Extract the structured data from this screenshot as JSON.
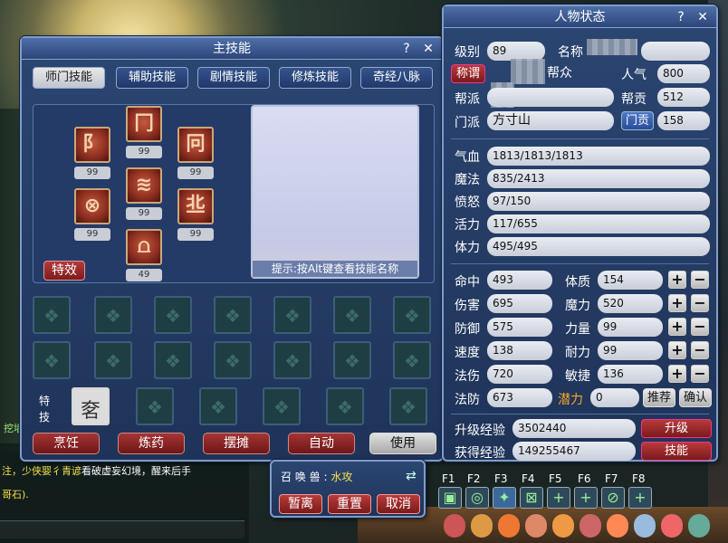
{
  "skill_window": {
    "title": "主技能",
    "help": "?",
    "close": "✕",
    "tabs": [
      "师门技能",
      "辅助技能",
      "剧情技能",
      "修炼技能",
      "奇经八脉"
    ],
    "skills": [
      {
        "glyph": "阝",
        "level": "99"
      },
      {
        "glyph": "冂",
        "level": "99"
      },
      {
        "glyph": "冋",
        "level": "99"
      },
      {
        "glyph": "⊗",
        "level": "99"
      },
      {
        "glyph": "≋",
        "level": "99"
      },
      {
        "glyph": "丠",
        "level": "99"
      },
      {
        "glyph": "⩍",
        "level": "49"
      }
    ],
    "tip": "提示:按Alt键查看技能名称",
    "effect_button": "特效",
    "special_label": "特技",
    "special_glyph": "㚚",
    "actions": [
      "烹饪",
      "炼药",
      "摆摊",
      "自动",
      "使用"
    ]
  },
  "status_window": {
    "title": "人物状态",
    "help": "?",
    "close": "✕",
    "level_label": "级别",
    "level_value": "89",
    "name_label": "名称",
    "title_button": "称谓",
    "title_value": "帮众",
    "popularity_label": "人气",
    "popularity_value": "800",
    "guild_label": "帮派",
    "guild_contrib_label": "帮贡",
    "guild_contrib_value": "512",
    "school_label": "门派",
    "school_value": "方寸山",
    "school_contrib_button": "门贡",
    "school_contrib_value": "158",
    "hp_label": "气血",
    "hp_value": "1813/1813/1813",
    "mp_label": "魔法",
    "mp_value": "835/2413",
    "rage_label": "愤怒",
    "rage_value": "97/150",
    "vigor_label": "活力",
    "vigor_value": "117/655",
    "stamina_label": "体力",
    "stamina_value": "495/495",
    "stats": [
      {
        "label": "命中",
        "value": "493",
        "attr_label": "体质",
        "attr_value": "154"
      },
      {
        "label": "伤害",
        "value": "695",
        "attr_label": "魔力",
        "attr_value": "520"
      },
      {
        "label": "防御",
        "value": "575",
        "attr_label": "力量",
        "attr_value": "99"
      },
      {
        "label": "速度",
        "value": "138",
        "attr_label": "耐力",
        "attr_value": "99"
      },
      {
        "label": "法伤",
        "value": "720",
        "attr_label": "敏捷",
        "attr_value": "136"
      }
    ],
    "mres_label": "法防",
    "mres_value": "673",
    "potential_label": "潜力",
    "potential_value": "0",
    "recommend_button": "推荐",
    "confirm_button": "确认",
    "upgrade_exp_label": "升级经验",
    "upgrade_exp_value": "3502440",
    "upgrade_button": "升级",
    "gained_exp_label": "获得经验",
    "gained_exp_value": "149255467",
    "skill_button": "技能",
    "plus": "+",
    "minus": "−"
  },
  "pet_window": {
    "label": "召 唤 兽 :",
    "pet_name": "水攻",
    "buttons": [
      "暂离",
      "重置",
      "取消"
    ]
  },
  "fkeys": [
    "F1",
    "F2",
    "F3",
    "F4",
    "F5",
    "F6",
    "F7",
    "F8"
  ],
  "chat": {
    "line1": "挖墙",
    "line2": "注，少侠婴彳青谚",
    "line2b": "看破虚妄幻境，醒来后手",
    "line3": "哥石)."
  }
}
